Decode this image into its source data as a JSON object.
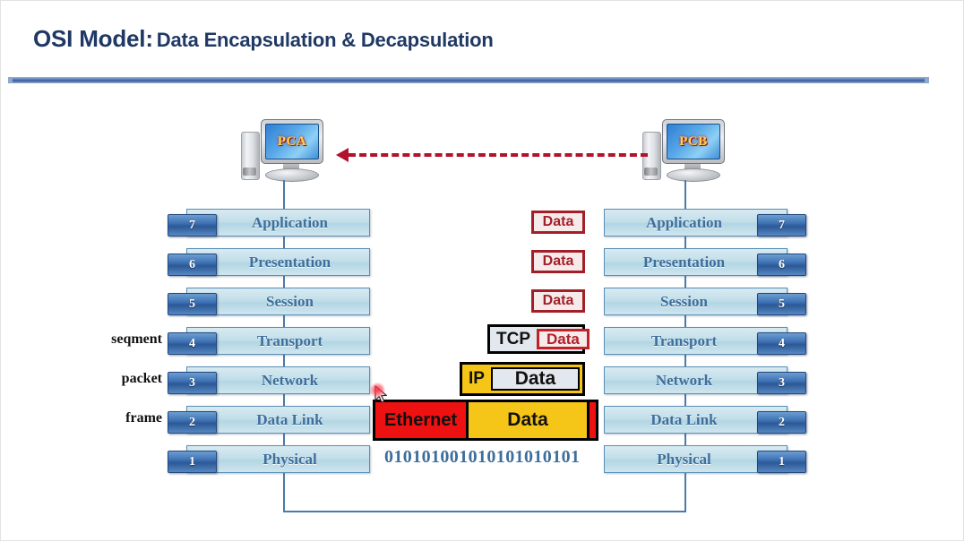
{
  "header": {
    "title_main": "OSI Model:",
    "title_sub": "Data Encapsulation & Decapsulation"
  },
  "hosts": {
    "left": {
      "label": "PCA",
      "name": "pc-a"
    },
    "right": {
      "label": "PCB",
      "name": "pc-b"
    }
  },
  "arrow": {
    "direction": "right-to-left",
    "color": "#B2122B",
    "style": "dashed"
  },
  "left_stack": {
    "title": "PCA OSI layers",
    "layers": [
      {
        "number": "7",
        "label": "Application",
        "pdu": ""
      },
      {
        "number": "6",
        "label": "Presentation",
        "pdu": ""
      },
      {
        "number": "5",
        "label": "Session",
        "pdu": ""
      },
      {
        "number": "4",
        "label": "Transport",
        "pdu": "seqment"
      },
      {
        "number": "3",
        "label": "Network",
        "pdu": "packet"
      },
      {
        "number": "2",
        "label": "Data Link",
        "pdu": "frame"
      },
      {
        "number": "1",
        "label": "Physical",
        "pdu": ""
      }
    ]
  },
  "right_stack": {
    "title": "PCB OSI layers",
    "layers": [
      {
        "number": "7",
        "label": "Application"
      },
      {
        "number": "6",
        "label": "Presentation"
      },
      {
        "number": "5",
        "label": "Session"
      },
      {
        "number": "4",
        "label": "Transport"
      },
      {
        "number": "3",
        "label": "Network"
      },
      {
        "number": "2",
        "label": "Data Link"
      },
      {
        "number": "1",
        "label": "Physical"
      }
    ]
  },
  "encapsulation": {
    "rows": [
      {
        "id": "app",
        "kind": "data",
        "data_label": "Data"
      },
      {
        "id": "pres",
        "kind": "data",
        "data_label": "Data"
      },
      {
        "id": "sess",
        "kind": "data",
        "data_label": "Data"
      },
      {
        "id": "tcp",
        "kind": "tcp",
        "header_label": "TCP",
        "data_label": "Data"
      },
      {
        "id": "ip",
        "kind": "ip",
        "header_label": "IP",
        "data_label": "Data"
      },
      {
        "id": "eth",
        "kind": "ethernet",
        "header_label": "Ethernet",
        "data_label": "Data"
      }
    ],
    "bits": "010101001010101010101"
  },
  "colors": {
    "title": "#1F3864",
    "layer_fill": "#c3dfea",
    "layer_text": "#3E6E9B",
    "badge": "#2C5896",
    "data_red": "#A31F28",
    "ip_yellow": "#F5C518",
    "ethernet_red": "#EE1111",
    "arrow_red": "#B2122B",
    "connector_blue": "#4A7AA8"
  }
}
